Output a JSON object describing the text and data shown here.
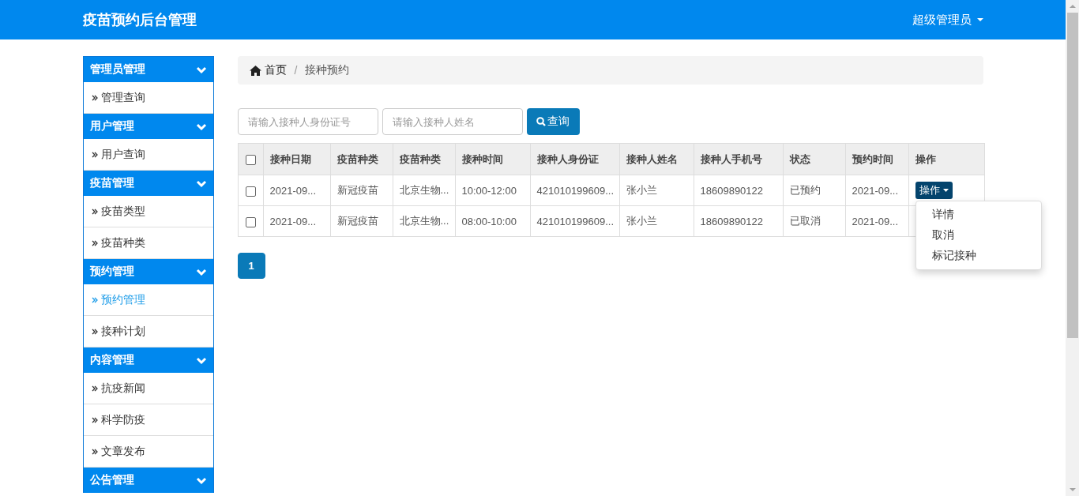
{
  "navbar": {
    "brand": "疫苗预约后台管理",
    "user_menu": "超级管理员"
  },
  "sidebar": {
    "groups": [
      {
        "title": "管理员管理",
        "expanded": true,
        "items": [
          {
            "label": "管理查询",
            "selected": false
          }
        ]
      },
      {
        "title": "用户管理",
        "expanded": true,
        "items": [
          {
            "label": "用户查询",
            "selected": false
          }
        ]
      },
      {
        "title": "疫苗管理",
        "expanded": true,
        "items": [
          {
            "label": "疫苗类型",
            "selected": false
          },
          {
            "label": "疫苗种类",
            "selected": false
          }
        ]
      },
      {
        "title": "预约管理",
        "expanded": true,
        "items": [
          {
            "label": "预约管理",
            "selected": true
          },
          {
            "label": "接种计划",
            "selected": false
          }
        ]
      },
      {
        "title": "内容管理",
        "expanded": true,
        "items": [
          {
            "label": "抗疫新闻",
            "selected": false
          },
          {
            "label": "科学防疫",
            "selected": false
          },
          {
            "label": "文章发布",
            "selected": false
          }
        ]
      },
      {
        "title": "公告管理",
        "expanded": true
      }
    ]
  },
  "breadcrumb": {
    "separator": "/",
    "items": [
      "首页",
      "接种预约"
    ]
  },
  "search": {
    "id_placeholder": "请输入接种人身份证号",
    "name_placeholder": "请输入接种人姓名",
    "button": "查询"
  },
  "table": {
    "select_all_checked": false,
    "columns": [
      "接种日期",
      "疫苗种类",
      "疫苗种类",
      "接种时间",
      "接种人身份证",
      "接种人姓名",
      "接种人手机号",
      "状态",
      "预约时间",
      "操作"
    ],
    "rows": [
      {
        "checked": false,
        "cells": [
          "2021-09...",
          "新冠疫苗",
          "北京生物...",
          "10:00-12:00",
          "421010199609...",
          "张小兰",
          "18609890122",
          "已预约",
          "2021-09..."
        ],
        "action": "操作"
      },
      {
        "checked": false,
        "cells": [
          "2021-09...",
          "新冠疫苗",
          "北京生物...",
          "08:00-10:00",
          "421010199609...",
          "张小兰",
          "18609890122",
          "已取消",
          "2021-09..."
        ]
      }
    ]
  },
  "action_menu": [
    "详情",
    "取消",
    "标记接种"
  ],
  "pagination": [
    {
      "label": "1",
      "selected": true
    }
  ]
}
